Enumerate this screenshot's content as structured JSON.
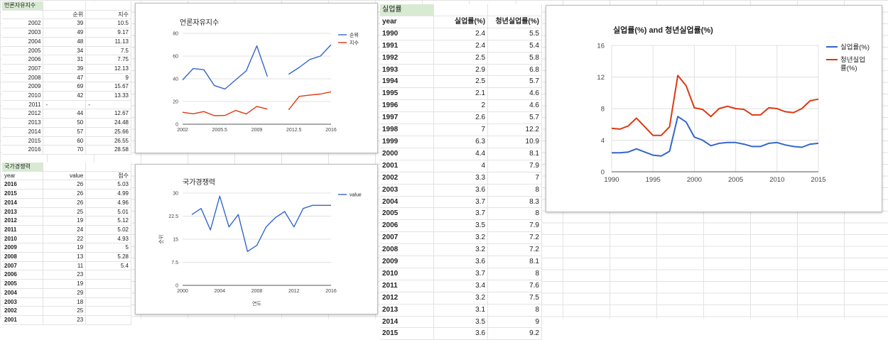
{
  "press": {
    "title": "언론자유지수",
    "headers": [
      "",
      "순위",
      "지수"
    ],
    "rows": [
      [
        "2002",
        "39",
        "10.5"
      ],
      [
        "2003",
        "49",
        "9.17"
      ],
      [
        "2004",
        "48",
        "11.13"
      ],
      [
        "2005",
        "34",
        "7.5"
      ],
      [
        "2006",
        "31",
        "7.75"
      ],
      [
        "2007",
        "39",
        "12.13"
      ],
      [
        "2008",
        "47",
        "9"
      ],
      [
        "2009",
        "69",
        "15.67"
      ],
      [
        "2010",
        "42",
        "13.33"
      ],
      [
        "2011",
        "-",
        "-"
      ],
      [
        "2012",
        "44",
        "12.67"
      ],
      [
        "2013",
        "50",
        "24.48"
      ],
      [
        "2014",
        "57",
        "25.66"
      ],
      [
        "2015",
        "60",
        "26.55"
      ],
      [
        "2016",
        "70",
        "28.58"
      ]
    ]
  },
  "comp": {
    "title": "국가경쟁력",
    "headers": [
      "year",
      "value",
      "점수"
    ],
    "rows": [
      [
        "2016",
        "26",
        "5.03"
      ],
      [
        "2015",
        "26",
        "4.99"
      ],
      [
        "2014",
        "26",
        "4.96"
      ],
      [
        "2013",
        "25",
        "5.01"
      ],
      [
        "2012",
        "19",
        "5.12"
      ],
      [
        "2011",
        "24",
        "5.02"
      ],
      [
        "2010",
        "22",
        "4.93"
      ],
      [
        "2009",
        "19",
        "5"
      ],
      [
        "2008",
        "13",
        "5.28"
      ],
      [
        "2007",
        "11",
        "5.4"
      ],
      [
        "2006",
        "23",
        ""
      ],
      [
        "2005",
        "19",
        ""
      ],
      [
        "2004",
        "29",
        ""
      ],
      [
        "2003",
        "18",
        ""
      ],
      [
        "2002",
        "25",
        ""
      ],
      [
        "2001",
        "23",
        ""
      ]
    ]
  },
  "unemp": {
    "title": "실업률",
    "headers": [
      "year",
      "실업률(%)",
      "청년실업률(%)"
    ],
    "rows": [
      [
        "1990",
        "2.4",
        "5.5"
      ],
      [
        "1991",
        "2.4",
        "5.4"
      ],
      [
        "1992",
        "2.5",
        "5.8"
      ],
      [
        "1993",
        "2.9",
        "6.8"
      ],
      [
        "1994",
        "2.5",
        "5.7"
      ],
      [
        "1995",
        "2.1",
        "4.6"
      ],
      [
        "1996",
        "2",
        "4.6"
      ],
      [
        "1997",
        "2.6",
        "5.7"
      ],
      [
        "1998",
        "7",
        "12.2"
      ],
      [
        "1999",
        "6.3",
        "10.9"
      ],
      [
        "2000",
        "4.4",
        "8.1"
      ],
      [
        "2001",
        "4",
        "7.9"
      ],
      [
        "2002",
        "3.3",
        "7"
      ],
      [
        "2003",
        "3.6",
        "8"
      ],
      [
        "2004",
        "3.7",
        "8.3"
      ],
      [
        "2005",
        "3.7",
        "8"
      ],
      [
        "2006",
        "3.5",
        "7.9"
      ],
      [
        "2007",
        "3.2",
        "7.2"
      ],
      [
        "2008",
        "3.2",
        "7.2"
      ],
      [
        "2009",
        "3.6",
        "8.1"
      ],
      [
        "2010",
        "3.7",
        "8"
      ],
      [
        "2011",
        "3.4",
        "7.6"
      ],
      [
        "2012",
        "3.2",
        "7.5"
      ],
      [
        "2013",
        "3.1",
        "8"
      ],
      [
        "2014",
        "3.5",
        "9"
      ],
      [
        "2015",
        "3.6",
        "9.2"
      ]
    ]
  },
  "chart_data": [
    {
      "type": "line",
      "title": "언론자유지수",
      "xlabel": "",
      "ylabel": "",
      "xlim": [
        2002,
        2016
      ],
      "ylim": [
        0,
        80
      ],
      "x_ticks": [
        "2002",
        "2005.5",
        "2009",
        "2012.5",
        "2016"
      ],
      "y_ticks": [
        "0",
        "20",
        "40",
        "60",
        "80"
      ],
      "legend": "right",
      "x": [
        2002,
        2003,
        2004,
        2005,
        2006,
        2007,
        2008,
        2009,
        2010,
        2011,
        2012,
        2013,
        2014,
        2015,
        2016
      ],
      "series": [
        {
          "name": "순위",
          "color": "#3366cc",
          "values": [
            39,
            49,
            48,
            34,
            31,
            39,
            47,
            69,
            42,
            null,
            44,
            50,
            57,
            60,
            70
          ]
        },
        {
          "name": "지수",
          "color": "#dc3912",
          "values": [
            10.5,
            9.17,
            11.13,
            7.5,
            7.75,
            12.13,
            9,
            15.67,
            13.33,
            null,
            12.67,
            24.48,
            25.66,
            26.55,
            28.58
          ]
        }
      ]
    },
    {
      "type": "line",
      "title": "국가경쟁력",
      "xlabel": "연도",
      "ylabel": "순위",
      "xlim": [
        2000,
        2016
      ],
      "ylim": [
        0,
        30
      ],
      "x_ticks": [
        "2000",
        "2004",
        "2008",
        "2012",
        "2016"
      ],
      "y_ticks": [
        "0",
        "7.5",
        "15",
        "22.5",
        "30"
      ],
      "legend": "right",
      "x": [
        2001,
        2002,
        2003,
        2004,
        2005,
        2006,
        2007,
        2008,
        2009,
        2010,
        2011,
        2012,
        2013,
        2014,
        2015,
        2016
      ],
      "series": [
        {
          "name": "value",
          "color": "#3366cc",
          "values": [
            23,
            25,
            18,
            29,
            19,
            23,
            11,
            13,
            19,
            22,
            24,
            19,
            25,
            26,
            26,
            26
          ]
        }
      ]
    },
    {
      "type": "line",
      "title": "실업률(%) and 청년실업률(%)",
      "xlabel": "",
      "ylabel": "",
      "xlim": [
        1990,
        2015
      ],
      "ylim": [
        0,
        16
      ],
      "x_ticks": [
        "1990",
        "1995",
        "2000",
        "2005",
        "2010",
        "2015"
      ],
      "y_ticks": [
        "0",
        "4",
        "8",
        "12",
        "16"
      ],
      "legend": "right",
      "x": [
        1990,
        1991,
        1992,
        1993,
        1994,
        1995,
        1996,
        1997,
        1998,
        1999,
        2000,
        2001,
        2002,
        2003,
        2004,
        2005,
        2006,
        2007,
        2008,
        2009,
        2010,
        2011,
        2012,
        2013,
        2014,
        2015
      ],
      "series": [
        {
          "name": "실업률(%)",
          "color": "#3366cc",
          "values": [
            2.4,
            2.4,
            2.5,
            2.9,
            2.5,
            2.1,
            2,
            2.6,
            7,
            6.3,
            4.4,
            4,
            3.3,
            3.6,
            3.7,
            3.7,
            3.5,
            3.2,
            3.2,
            3.6,
            3.7,
            3.4,
            3.2,
            3.1,
            3.5,
            3.6
          ]
        },
        {
          "name": "청년실업률(%)",
          "color": "#dc3912",
          "values": [
            5.5,
            5.4,
            5.8,
            6.8,
            5.7,
            4.6,
            4.6,
            5.7,
            12.2,
            10.9,
            8.1,
            7.9,
            7,
            8,
            8.3,
            8,
            7.9,
            7.2,
            7.2,
            8.1,
            8,
            7.6,
            7.5,
            8,
            9,
            9.2
          ]
        }
      ]
    }
  ]
}
